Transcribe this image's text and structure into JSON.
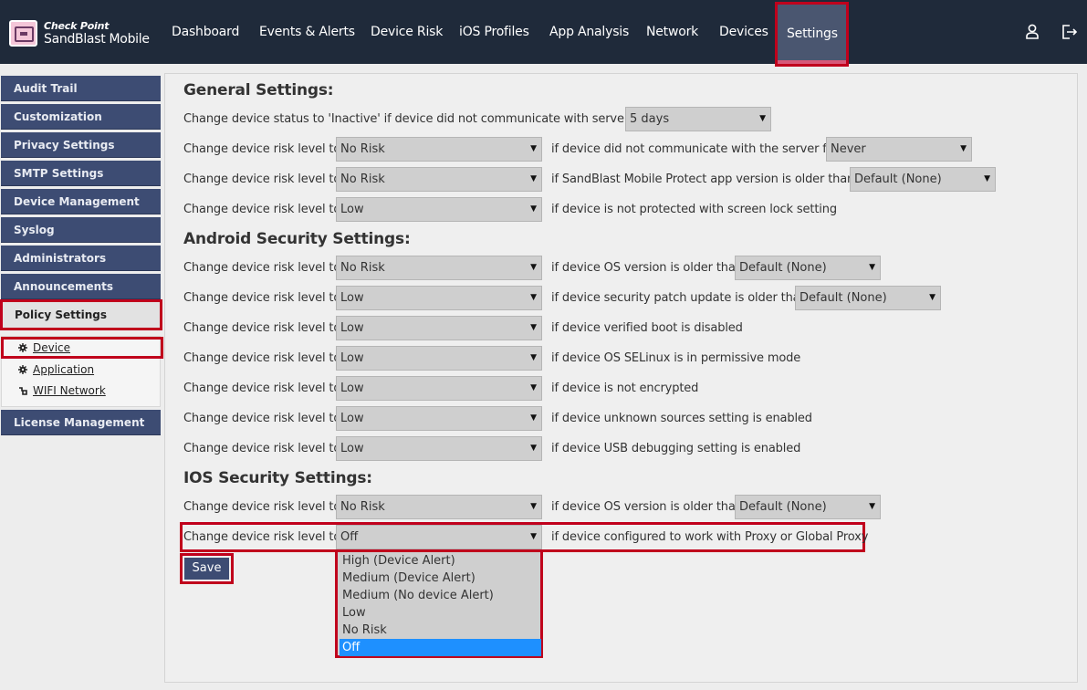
{
  "brand": {
    "company": "Check Point",
    "product": "SandBlast Mobile"
  },
  "nav": {
    "items": [
      {
        "id": "dashboard",
        "label": "Dashboard"
      },
      {
        "id": "events",
        "label": "Events & Alerts"
      },
      {
        "id": "device-risk",
        "label": "Device Risk"
      },
      {
        "id": "ios-profiles",
        "label": "iOS Profiles"
      },
      {
        "id": "app-analysis",
        "label": "App Analysis"
      },
      {
        "id": "network",
        "label": "Network"
      },
      {
        "id": "devices",
        "label": "Devices"
      },
      {
        "id": "settings",
        "label": "Settings",
        "active": true
      }
    ],
    "icons": [
      "user-icon",
      "logout-icon"
    ]
  },
  "sidebar": {
    "items": [
      {
        "label": "Audit Trail"
      },
      {
        "label": "Customization"
      },
      {
        "label": "Privacy Settings"
      },
      {
        "label": "SMTP Settings"
      },
      {
        "label": "Device Management"
      },
      {
        "label": "Syslog"
      },
      {
        "label": "Administrators"
      },
      {
        "label": "Announcements"
      },
      {
        "label": "Policy Settings",
        "active": true
      },
      {
        "label": "License Management"
      }
    ],
    "policy_sub": [
      {
        "label": "Device",
        "icon": "gear-icon",
        "active": true
      },
      {
        "label": "Application",
        "icon": "gear-icon"
      },
      {
        "label": "WIFI Network",
        "icon": "wifi-icon"
      }
    ]
  },
  "general": {
    "title": "General Settings:",
    "inactive_label": "Change device status to 'Inactive' if device did not communicate with server for:",
    "inactive_value": "5 days",
    "rows": [
      {
        "label": "Change device risk level to:",
        "value": "No Risk",
        "condition": "if device did not communicate with the server for",
        "extra": "Never"
      },
      {
        "label": "Change device risk level to:",
        "value": "No Risk",
        "condition": "if SandBlast Mobile Protect app version is older than",
        "extra": "Default (None)"
      },
      {
        "label": "Change device risk level to:",
        "value": "Low",
        "condition": "if device is not protected with screen lock setting"
      }
    ]
  },
  "android": {
    "title": "Android Security Settings:",
    "rows": [
      {
        "label": "Change device risk level to:",
        "value": "No Risk",
        "condition": "if device OS version is older than",
        "extra": "Default (None)"
      },
      {
        "label": "Change device risk level to:",
        "value": "Low",
        "condition": "if device security patch update is older than",
        "extra": "Default (None)"
      },
      {
        "label": "Change device risk level to:",
        "value": "Low",
        "condition": "if device verified boot is disabled"
      },
      {
        "label": "Change device risk level to:",
        "value": "Low",
        "condition": "if device OS SELinux is in permissive mode"
      },
      {
        "label": "Change device risk level to:",
        "value": "Low",
        "condition": "if device is not encrypted"
      },
      {
        "label": "Change device risk level to:",
        "value": "Low",
        "condition": "if device unknown sources setting is enabled"
      },
      {
        "label": "Change device risk level to:",
        "value": "Low",
        "condition": "if device USB debugging setting is enabled"
      }
    ]
  },
  "ios": {
    "title": "IOS Security Settings:",
    "rows": [
      {
        "label": "Change device risk level to:",
        "value": "No Risk",
        "condition": "if device OS version is older than",
        "extra": "Default (None)"
      },
      {
        "label": "Change device risk level to:",
        "value": "Off",
        "condition": "if device configured to work with Proxy or Global Proxy"
      }
    ]
  },
  "save_label": "Save",
  "dropdown": {
    "options": [
      {
        "label": "High (Device Alert)"
      },
      {
        "label": "Medium (Device Alert)"
      },
      {
        "label": "Medium (No device Alert)"
      },
      {
        "label": "Low"
      },
      {
        "label": "No Risk"
      },
      {
        "label": "Off",
        "selected": true
      }
    ]
  },
  "arrow_glyph": "▼",
  "colors": {
    "nav_bg": "#1f2a3a",
    "sidebar_item": "#3d4c73",
    "highlight": "#c0001c",
    "selected_option": "#1e90ff"
  }
}
